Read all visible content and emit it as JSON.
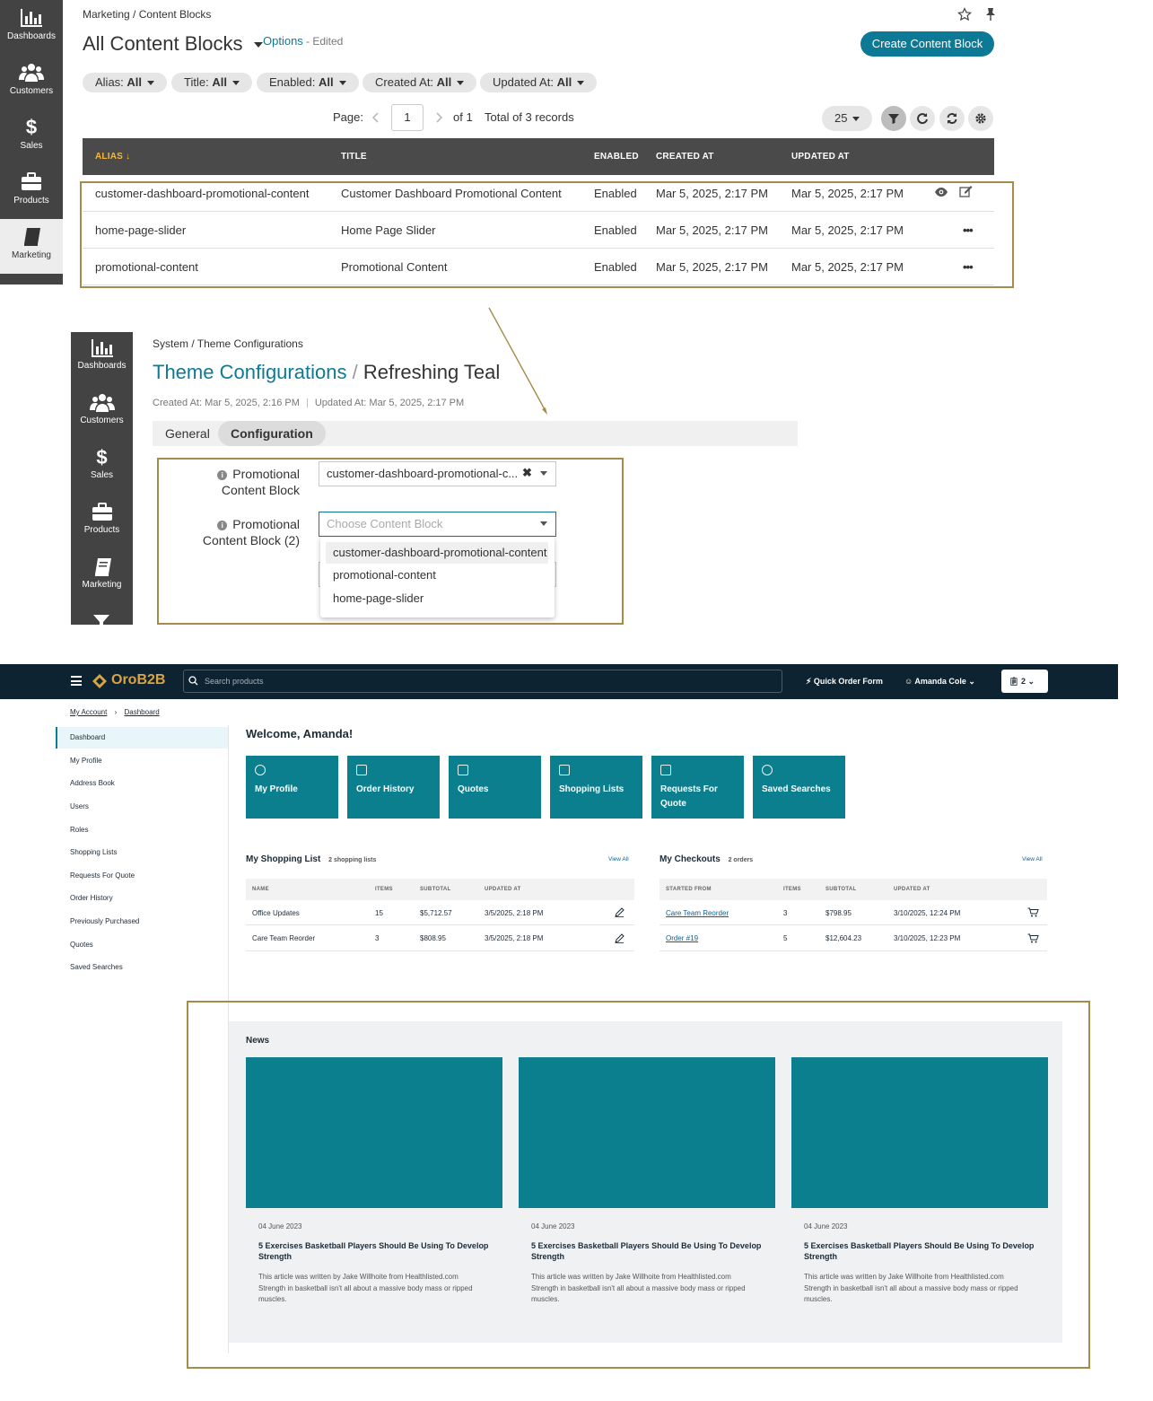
{
  "panel1": {
    "sidebar": [
      {
        "label": "Dashboards",
        "icon": "bar-chart-icon"
      },
      {
        "label": "Customers",
        "icon": "users-icon"
      },
      {
        "label": "Sales",
        "icon": "dollar-icon"
      },
      {
        "label": "Products",
        "icon": "briefcase-icon"
      },
      {
        "label": "Marketing",
        "icon": "book-icon"
      }
    ],
    "breadcrumb": "Marketing / Content Blocks",
    "title": "All Content Blocks",
    "options": "Options",
    "edited": "- Edited",
    "create_button": "Create Content Block",
    "filters": [
      {
        "name": "Alias:",
        "value": "All"
      },
      {
        "name": "Title:",
        "value": "All"
      },
      {
        "name": "Enabled:",
        "value": "All"
      },
      {
        "name": "Created At:",
        "value": "All"
      },
      {
        "name": "Updated At:",
        "value": "All"
      }
    ],
    "pager": {
      "page_label": "Page:",
      "page": "1",
      "of": "of 1",
      "total": "Total of 3 records",
      "per_page": "25"
    },
    "columns": [
      "ALIAS",
      "TITLE",
      "ENABLED",
      "CREATED AT",
      "UPDATED AT"
    ],
    "rows": [
      {
        "alias": "customer-dashboard-promotional-content",
        "title": "Customer Dashboard Promotional Content",
        "enabled": "Enabled",
        "created": "Mar 5, 2025, 2:17 PM",
        "updated": "Mar 5, 2025, 2:17 PM"
      },
      {
        "alias": "home-page-slider",
        "title": "Home Page Slider",
        "enabled": "Enabled",
        "created": "Mar 5, 2025, 2:17 PM",
        "updated": "Mar 5, 2025, 2:17 PM"
      },
      {
        "alias": "promotional-content",
        "title": "Promotional Content",
        "enabled": "Enabled",
        "created": "Mar 5, 2025, 2:17 PM",
        "updated": "Mar 5, 2025, 2:17 PM"
      }
    ],
    "accent": "#0c7a97",
    "highlight": "#a68b4a"
  },
  "panel2": {
    "sidebar": [
      {
        "label": "Dashboards"
      },
      {
        "label": "Customers"
      },
      {
        "label": "Sales"
      },
      {
        "label": "Products"
      },
      {
        "label": "Marketing"
      }
    ],
    "breadcrumb": "System / Theme Configurations",
    "title_link": "Theme Configurations",
    "title_sep": "/",
    "title_name": "Refreshing Teal",
    "created": "Created At: Mar 5, 2025, 2:16 PM",
    "updated": "Updated At: Mar 5, 2025, 2:17 PM",
    "tabs": [
      "General",
      "Configuration"
    ],
    "field1_label": "Promotional Content Block",
    "field1_value": "customer-dashboard-promotional-c...",
    "field2_label": "Promotional Content Block (2)",
    "field2_placeholder": "Choose Content Block",
    "dropdown_options": [
      "customer-dashboard-promotional-content",
      "promotional-content",
      "home-page-slider"
    ]
  },
  "panel3": {
    "brand": "OroB2B",
    "search_placeholder": "Search products",
    "quick_order": "Quick Order Form",
    "user": "Amanda Cole",
    "cart_count": "2",
    "breadcrumb": [
      "My Account",
      "Dashboard"
    ],
    "side_menu": [
      "Dashboard",
      "My Profile",
      "Address Book",
      "Users",
      "Roles",
      "Shopping Lists",
      "Requests For Quote",
      "Order History",
      "Previously Purchased",
      "Quotes",
      "Saved Searches"
    ],
    "welcome": "Welcome, Amanda!",
    "tiles": [
      "My Profile",
      "Order History",
      "Quotes",
      "Shopping Lists",
      "Requests For Quote",
      "Saved Searches"
    ],
    "shopping": {
      "title": "My Shopping List",
      "count": "2 shopping lists",
      "view_all": "View All",
      "columns": [
        "NAME",
        "ITEMS",
        "SUBTOTAL",
        "UPDATED AT"
      ],
      "rows": [
        {
          "name": "Office Updates",
          "items": "15",
          "subtotal": "$5,712.57",
          "updated": "3/5/2025, 2:18 PM"
        },
        {
          "name": "Care Team Reorder",
          "items": "3",
          "subtotal": "$808.95",
          "updated": "3/5/2025, 2:18 PM"
        }
      ]
    },
    "checkouts": {
      "title": "My Checkouts",
      "count": "2 orders",
      "view_all": "View All",
      "columns": [
        "STARTED FROM",
        "ITEMS",
        "SUBTOTAL",
        "UPDATED AT"
      ],
      "rows": [
        {
          "name": "Care Team Reorder",
          "items": "3",
          "subtotal": "$798.95",
          "updated": "3/10/2025, 12:24 PM"
        },
        {
          "name": "Order #19",
          "items": "5",
          "subtotal": "$12,604.23",
          "updated": "3/10/2025, 12:23 PM"
        }
      ]
    },
    "news": {
      "title": "News",
      "items": [
        {
          "date": "04 June 2023",
          "title": "5 Exercises Basketball Players Should Be Using To Develop Strength",
          "body": "This article was written by Jake Willhoite from Healthlisted.com Strength in basketball isn't all about a massive body mass or ripped muscles."
        },
        {
          "date": "04 June 2023",
          "title": "5 Exercises Basketball Players Should Be Using To Develop Strength",
          "body": "This article was written by Jake Willhoite from Healthlisted.com Strength in basketball isn't all about a massive body mass or ripped muscles."
        },
        {
          "date": "04 June 2023",
          "title": "5 Exercises Basketball Players Should Be Using To Develop Strength",
          "body": "This article was written by Jake Willhoite from Healthlisted.com Strength in basketball isn't all about a massive body mass or ripped muscles."
        }
      ]
    },
    "tile_color": "#0c7f8e"
  }
}
